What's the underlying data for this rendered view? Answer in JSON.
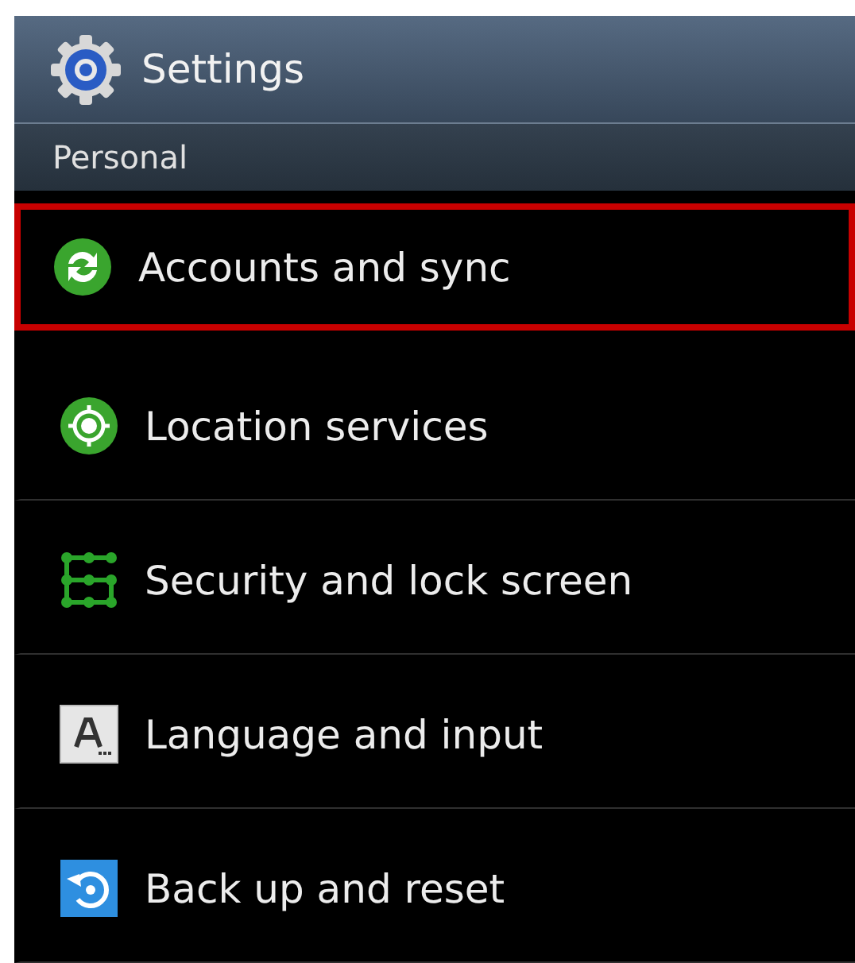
{
  "header": {
    "title": "Settings"
  },
  "section": {
    "title": "Personal"
  },
  "items": [
    {
      "label": "Accounts and sync",
      "kind": "sync",
      "selected": true
    },
    {
      "label": "Location services",
      "kind": "location",
      "selected": false
    },
    {
      "label": "Security and lock screen",
      "kind": "security",
      "selected": false
    },
    {
      "label": "Language and input",
      "kind": "language",
      "selected": false
    },
    {
      "label": "Back up and reset",
      "kind": "backup",
      "selected": false
    }
  ]
}
